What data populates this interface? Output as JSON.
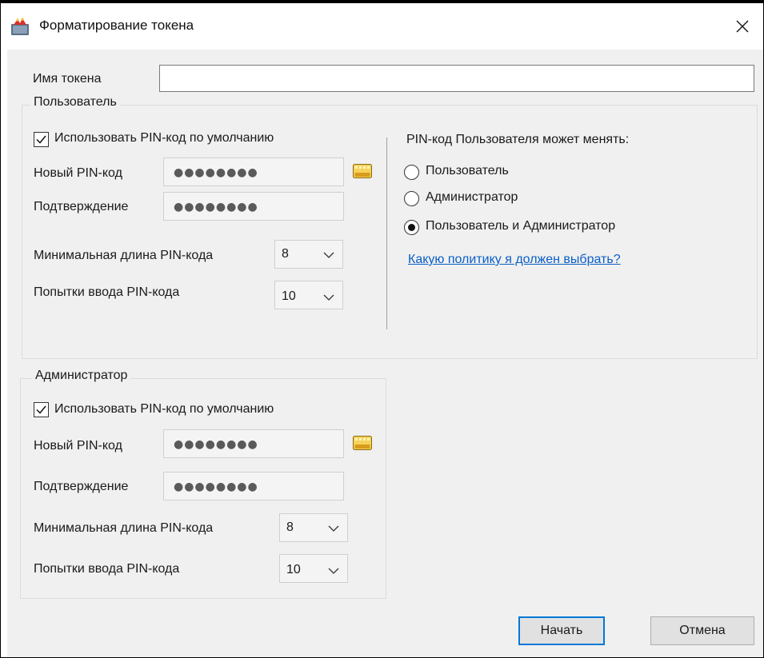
{
  "window": {
    "title": "Форматирование токена",
    "icons": {
      "app": "token-app-icon",
      "close": "close-icon"
    }
  },
  "token_name": {
    "label": "Имя токена",
    "value": ""
  },
  "user_group": {
    "title": "Пользователь",
    "use_default_pin": {
      "label": "Использовать PIN-код по умолчанию",
      "checked": true
    },
    "new_pin": {
      "label": "Новый PIN-код",
      "value": "●●●●●●●●"
    },
    "confirm_pin": {
      "label": "Подтверждение",
      "value": "●●●●●●●●"
    },
    "min_length": {
      "label": "Минимальная длина PIN-кода",
      "value": "8"
    },
    "attempts": {
      "label": "Попытки ввода PIN-кода",
      "value": "10"
    },
    "change_policy": {
      "heading": "PIN-код Пользователя может менять:",
      "options": [
        {
          "label": "Пользователь",
          "checked": false
        },
        {
          "label": "Администратор",
          "checked": false
        },
        {
          "label": "Пользователь и Администратор",
          "checked": true
        }
      ],
      "help_link": "Какую политику я должен выбрать?"
    }
  },
  "admin_group": {
    "title": "Администратор",
    "use_default_pin": {
      "label": "Использовать PIN-код по умолчанию",
      "checked": true
    },
    "new_pin": {
      "label": "Новый PIN-код",
      "value": "●●●●●●●●"
    },
    "confirm_pin": {
      "label": "Подтверждение",
      "value": "●●●●●●●●"
    },
    "min_length": {
      "label": "Минимальная длина PIN-кода",
      "value": "8"
    },
    "attempts": {
      "label": "Попытки ввода PIN-кода",
      "value": "10"
    }
  },
  "buttons": {
    "start": "Начать",
    "cancel": "Отмена"
  },
  "colors": {
    "accent": "#0078d7",
    "link": "#0a5fc8",
    "background": "#f0f0f0"
  }
}
